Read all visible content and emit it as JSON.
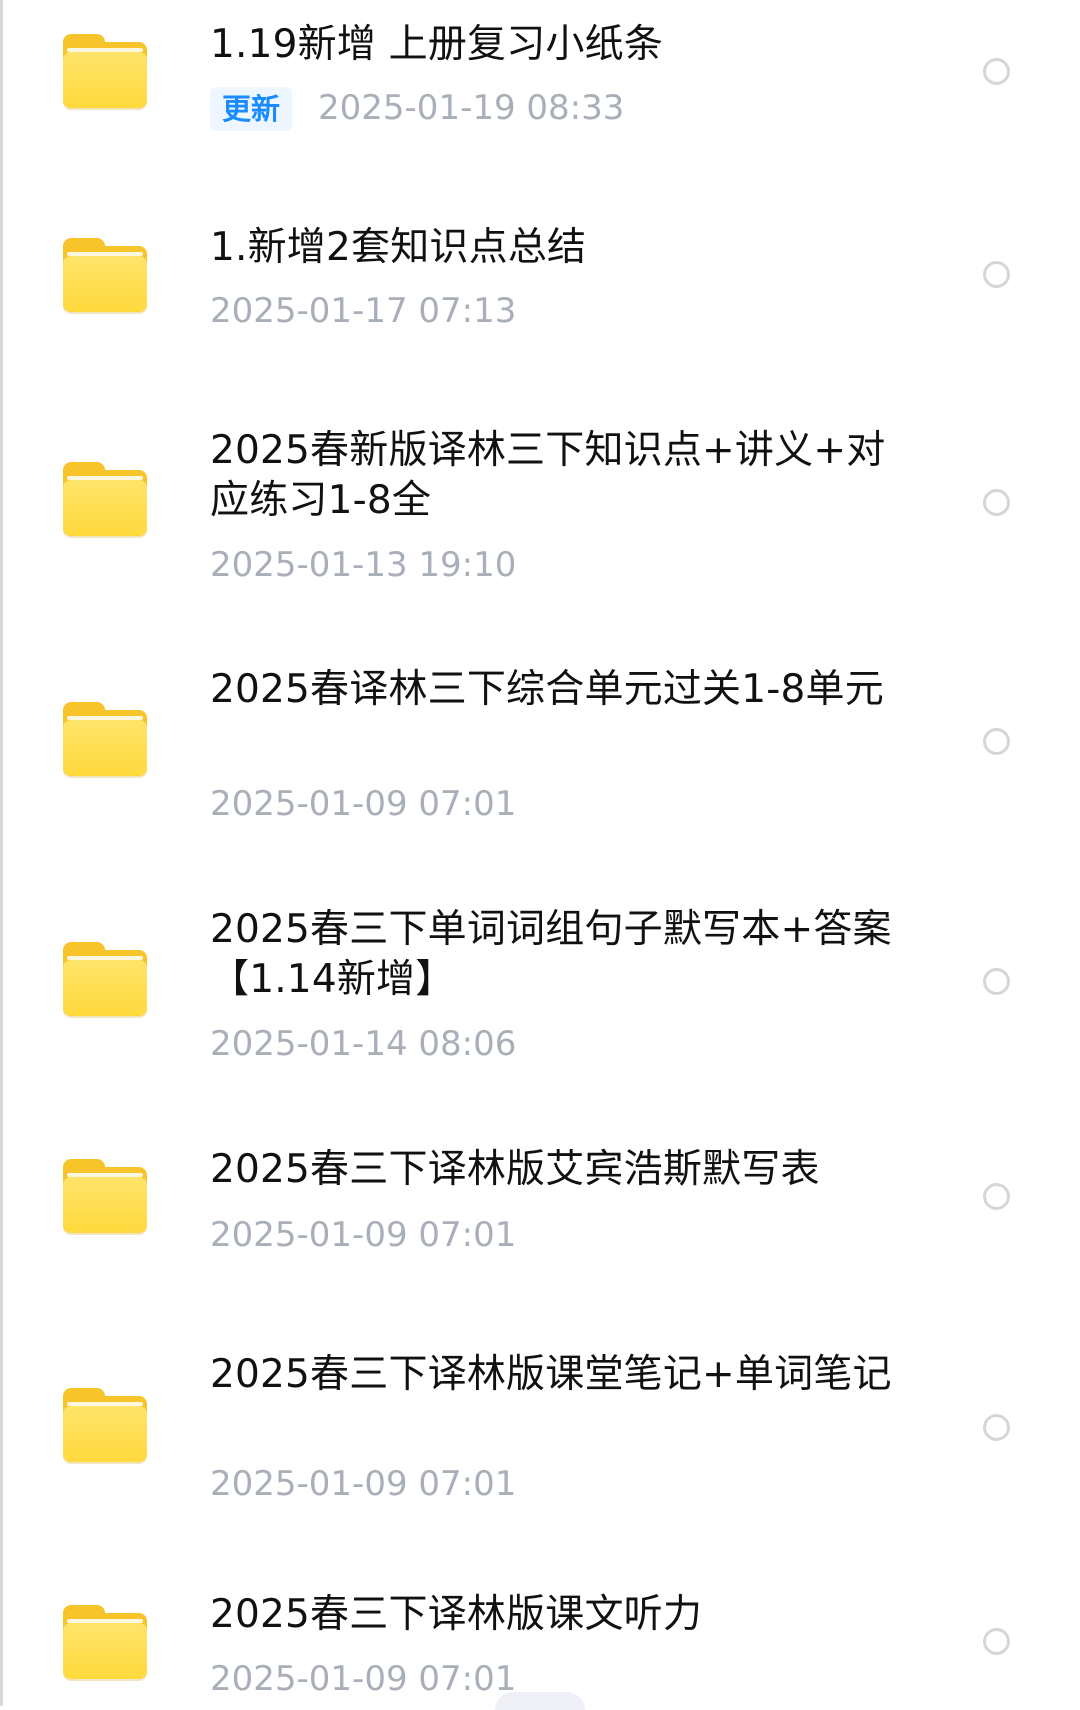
{
  "files": [
    {
      "name": "1.19新增 上册复习小纸条",
      "badge": "更新",
      "date": "2025-01-19  08:33"
    },
    {
      "name": "1.新增2套知识点总结",
      "badge": "",
      "date": "2025-01-17  07:13"
    },
    {
      "name": "2025春新版译林三下知识点+讲义+对应练习1-8全",
      "badge": "",
      "date": "2025-01-13  19:10"
    },
    {
      "name": "2025春译林三下综合单元过关1-8单元",
      "badge": "",
      "date": "2025-01-09  07:01"
    },
    {
      "name": "2025春三下单词词组句子默写本+答案【1.14新增】",
      "badge": "",
      "date": "2025-01-14  08:06"
    },
    {
      "name": "2025春三下译林版艾宾浩斯默写表",
      "badge": "",
      "date": "2025-01-09  07:01"
    },
    {
      "name": "2025春三下译林版课堂笔记+单词笔记",
      "badge": "",
      "date": "2025-01-09  07:01"
    },
    {
      "name": "2025春三下译林版课文听力",
      "badge": "",
      "date": "2025-01-09  07:01"
    }
  ],
  "colors": {
    "folder": "#ffd93c",
    "badge_text": "#1a8cff",
    "date_text": "#a9afb9",
    "title_text": "#111111"
  }
}
